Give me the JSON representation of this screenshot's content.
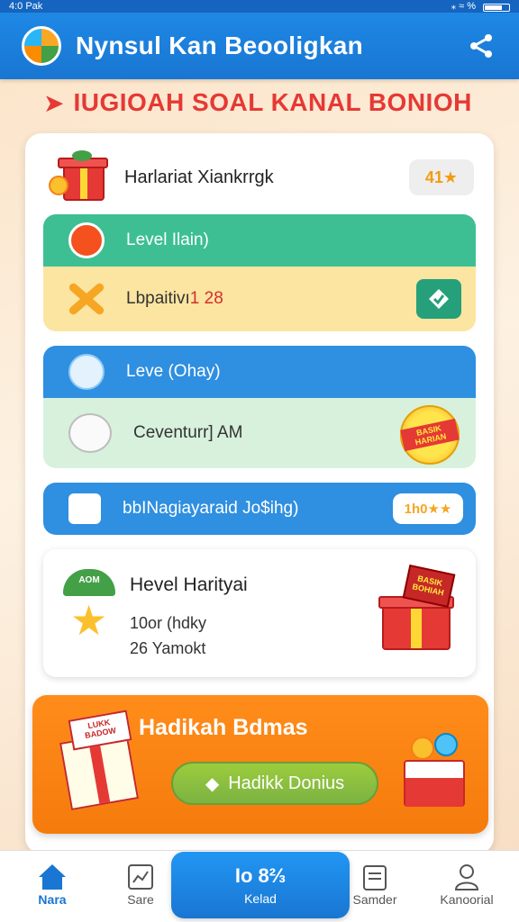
{
  "status_bar": {
    "left": "4:0 Pak",
    "right": "⁎ ≈ %"
  },
  "header": {
    "title": "Nynsul Kan Beooligkan"
  },
  "banner": {
    "text": "IUGIOAH SOAL KANAL BONIOH"
  },
  "task_card": {
    "title": "Harlariat Xiankrrgk",
    "badge": "41★",
    "rows": [
      {
        "label": "Level Ilain)"
      },
      {
        "label": "Lbpaitivı",
        "value": "1 28"
      },
      {
        "label": "Leve (Ohay)"
      },
      {
        "label": "Ceventurr] AM",
        "badge": "BASIK HARIAN"
      },
      {
        "label": "bbINagiayaraid Jo$ihg)",
        "badge": "1h0★★"
      }
    ]
  },
  "daily": {
    "umbrella_text": "AOM",
    "title": "Hevel Harityai",
    "line1": "10or (hdky",
    "line2": "26 Yamokt",
    "gift_tag": "BASIK BOHIAH"
  },
  "bonus": {
    "box_tag": "LUKK BADOW",
    "title": "Hadikah Bdmas",
    "button_label": "Hadikk Donius"
  },
  "bottom_nav": {
    "items": [
      {
        "label": "Nara"
      },
      {
        "label": "Sare"
      },
      {
        "label": "Samder"
      },
      {
        "label": "Kanoorial"
      }
    ],
    "center": {
      "top": "Io 8⅔",
      "label": "Kelad"
    }
  },
  "colors": {
    "primary": "#1976d2",
    "accent_red": "#e53935",
    "green": "#3dbf93",
    "orange": "#f57b0c"
  }
}
